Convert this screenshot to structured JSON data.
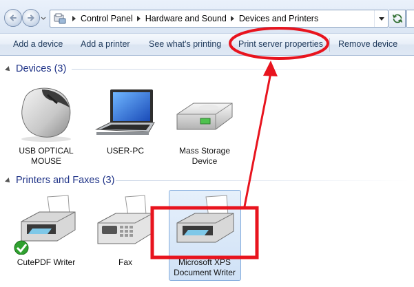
{
  "address_bar": {
    "breadcrumbs": [
      "Control Panel",
      "Hardware and Sound",
      "Devices and Printers"
    ]
  },
  "command_bar": {
    "items": [
      "Add a device",
      "Add a printer",
      "See what's printing",
      "Print server properties",
      "Remove device"
    ]
  },
  "groups": {
    "devices": {
      "title": "Devices (3)",
      "items": [
        {
          "label_line1": "USB OPTICAL",
          "label_line2": "MOUSE",
          "icon": "mouse-icon"
        },
        {
          "label_line1": "USER-PC",
          "label_line2": "",
          "icon": "laptop-icon"
        },
        {
          "label_line1": "Mass Storage",
          "label_line2": "Device",
          "icon": "hard-drive-icon"
        }
      ]
    },
    "printers": {
      "title": "Printers and Faxes (3)",
      "items": [
        {
          "label_line1": "CutePDF Writer",
          "label_line2": "",
          "icon": "printer-default-icon"
        },
        {
          "label_line1": "Fax",
          "label_line2": "",
          "icon": "fax-icon"
        },
        {
          "label_line1": "Microsoft XPS",
          "label_line2": "Document Writer",
          "icon": "printer-icon"
        }
      ]
    }
  },
  "colors": {
    "annotation_red": "#e8141e",
    "group_title": "#1e3287",
    "command_text": "#1e395b"
  }
}
